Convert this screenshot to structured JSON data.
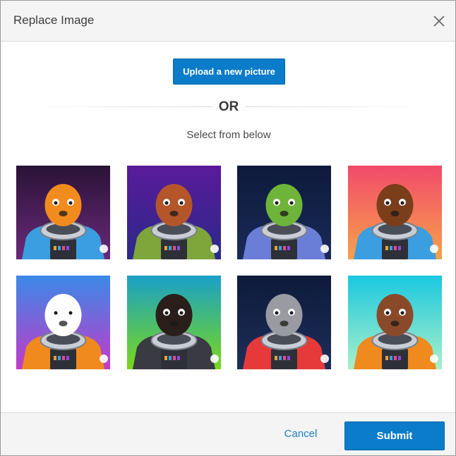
{
  "dialog": {
    "title": "Replace Image",
    "close_icon": "close-icon"
  },
  "upload": {
    "label": "Upload a new picture"
  },
  "divider": {
    "or_label": "OR"
  },
  "select_label": "Select from below",
  "avatars": [
    {
      "name": "fish-alien-astronaut",
      "bg": [
        "#2a1236",
        "#6a2a7a"
      ],
      "suit": "#3a9ee0",
      "head": "#f28b1e"
    },
    {
      "name": "wolf-astronaut",
      "bg": [
        "#5a1a9a",
        "#2a2a8a"
      ],
      "suit": "#7ea53a",
      "head": "#b5552a"
    },
    {
      "name": "green-alien-astronaut",
      "bg": [
        "#0d1a3a",
        "#1a2a5a"
      ],
      "suit": "#6a7ed8",
      "head": "#6fb43a"
    },
    {
      "name": "bigfoot-astronaut",
      "bg": [
        "#f24a6a",
        "#f7a24a"
      ],
      "suit": "#3a9ee0",
      "head": "#7a3e1a"
    },
    {
      "name": "panda-astronaut",
      "bg": [
        "#3a8ae8",
        "#c23ac8"
      ],
      "suit": "#f08a1e",
      "head": "#ffffff"
    },
    {
      "name": "rottweiler-astronaut",
      "bg": [
        "#1aa0c8",
        "#7ad81a"
      ],
      "suit": "#3a3a42",
      "head": "#2a1e1a"
    },
    {
      "name": "koala-astronaut",
      "bg": [
        "#0d1a3a",
        "#1e2e5a"
      ],
      "suit": "#e63a3a",
      "head": "#9a9aa2"
    },
    {
      "name": "monkey-astronaut",
      "bg": [
        "#1ac8e0",
        "#aaf0c8"
      ],
      "suit": "#f08a1e",
      "head": "#8a4a2a"
    }
  ],
  "footer": {
    "cancel_label": "Cancel",
    "submit_label": "Submit"
  },
  "colors": {
    "primary": "#0a7cc9",
    "link": "#1a7fc4",
    "header_bg": "#f4f4f4"
  }
}
